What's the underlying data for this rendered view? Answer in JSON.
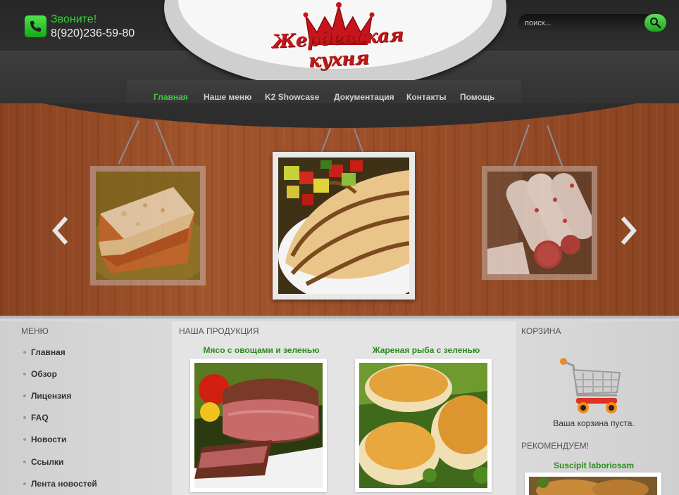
{
  "header": {
    "call_label": "Звоните!",
    "phone": "8(920)236-59-80",
    "logo_text": "Жердевская кухня",
    "search_placeholder": "поиск..."
  },
  "nav": {
    "items": [
      {
        "label": "Главная",
        "active": true
      },
      {
        "label": "Наше меню",
        "active": false
      },
      {
        "label": "K2 Showcase",
        "active": false
      },
      {
        "label": "Документация",
        "active": false
      },
      {
        "label": "Контакты",
        "active": false
      },
      {
        "label": "Помощь",
        "active": false
      }
    ],
    "active_color": "#3fc83f"
  },
  "slider": {
    "slides": [
      "lasagna-photo",
      "grilled-chicken-photo",
      "sausage-photo"
    ],
    "prev_icon": "chevron-left-icon",
    "next_icon": "chevron-right-icon"
  },
  "left_menu": {
    "title": "МЕНЮ",
    "items": [
      "Главная",
      "Обзор",
      "Лицензия",
      "FAQ",
      "Новости",
      "Ссылки",
      "Лента новостей"
    ]
  },
  "products": {
    "title": "НАША ПРОДУКЦИЯ",
    "items": [
      {
        "title": "Мясо с овощами и зеленью",
        "image": "steak-photo"
      },
      {
        "title": "Жареная рыба с зеленью",
        "image": "fried-fish-photo"
      }
    ]
  },
  "cart": {
    "title": "КОРЗИНА",
    "empty_text": "Ваша корзина пуста.",
    "icon": "shopping-cart-icon"
  },
  "recommended": {
    "title": "РЕКОМЕНДУЕМ!",
    "item_title": "Suscipit laboriosam"
  },
  "colors": {
    "accent_green": "#2c8a1f",
    "header_dark": "#2d2d2d",
    "logo_red": "#c01818"
  }
}
